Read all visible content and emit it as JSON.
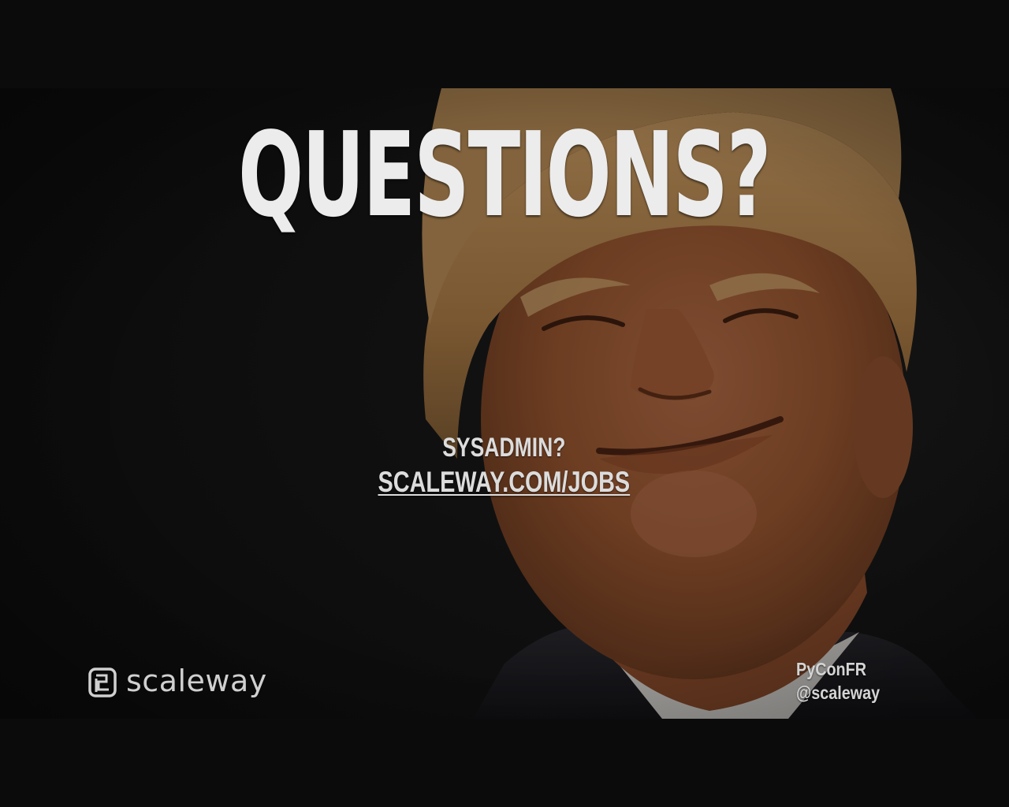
{
  "slide": {
    "title": "QUESTIONS?",
    "cta_question": "SYSADMIN?",
    "cta_link": "SCALEWAY.COM/JOBS"
  },
  "footer": {
    "brand_name": "scaleway",
    "brand_icon": "scaleway-logo-icon",
    "event": "PyConFR",
    "handle": "@scaleway"
  },
  "colors": {
    "letterbox": "#0b0b0b",
    "background": "#131313",
    "text": "#ececec",
    "skin": "#a8603d",
    "hair": "#b68a52"
  }
}
